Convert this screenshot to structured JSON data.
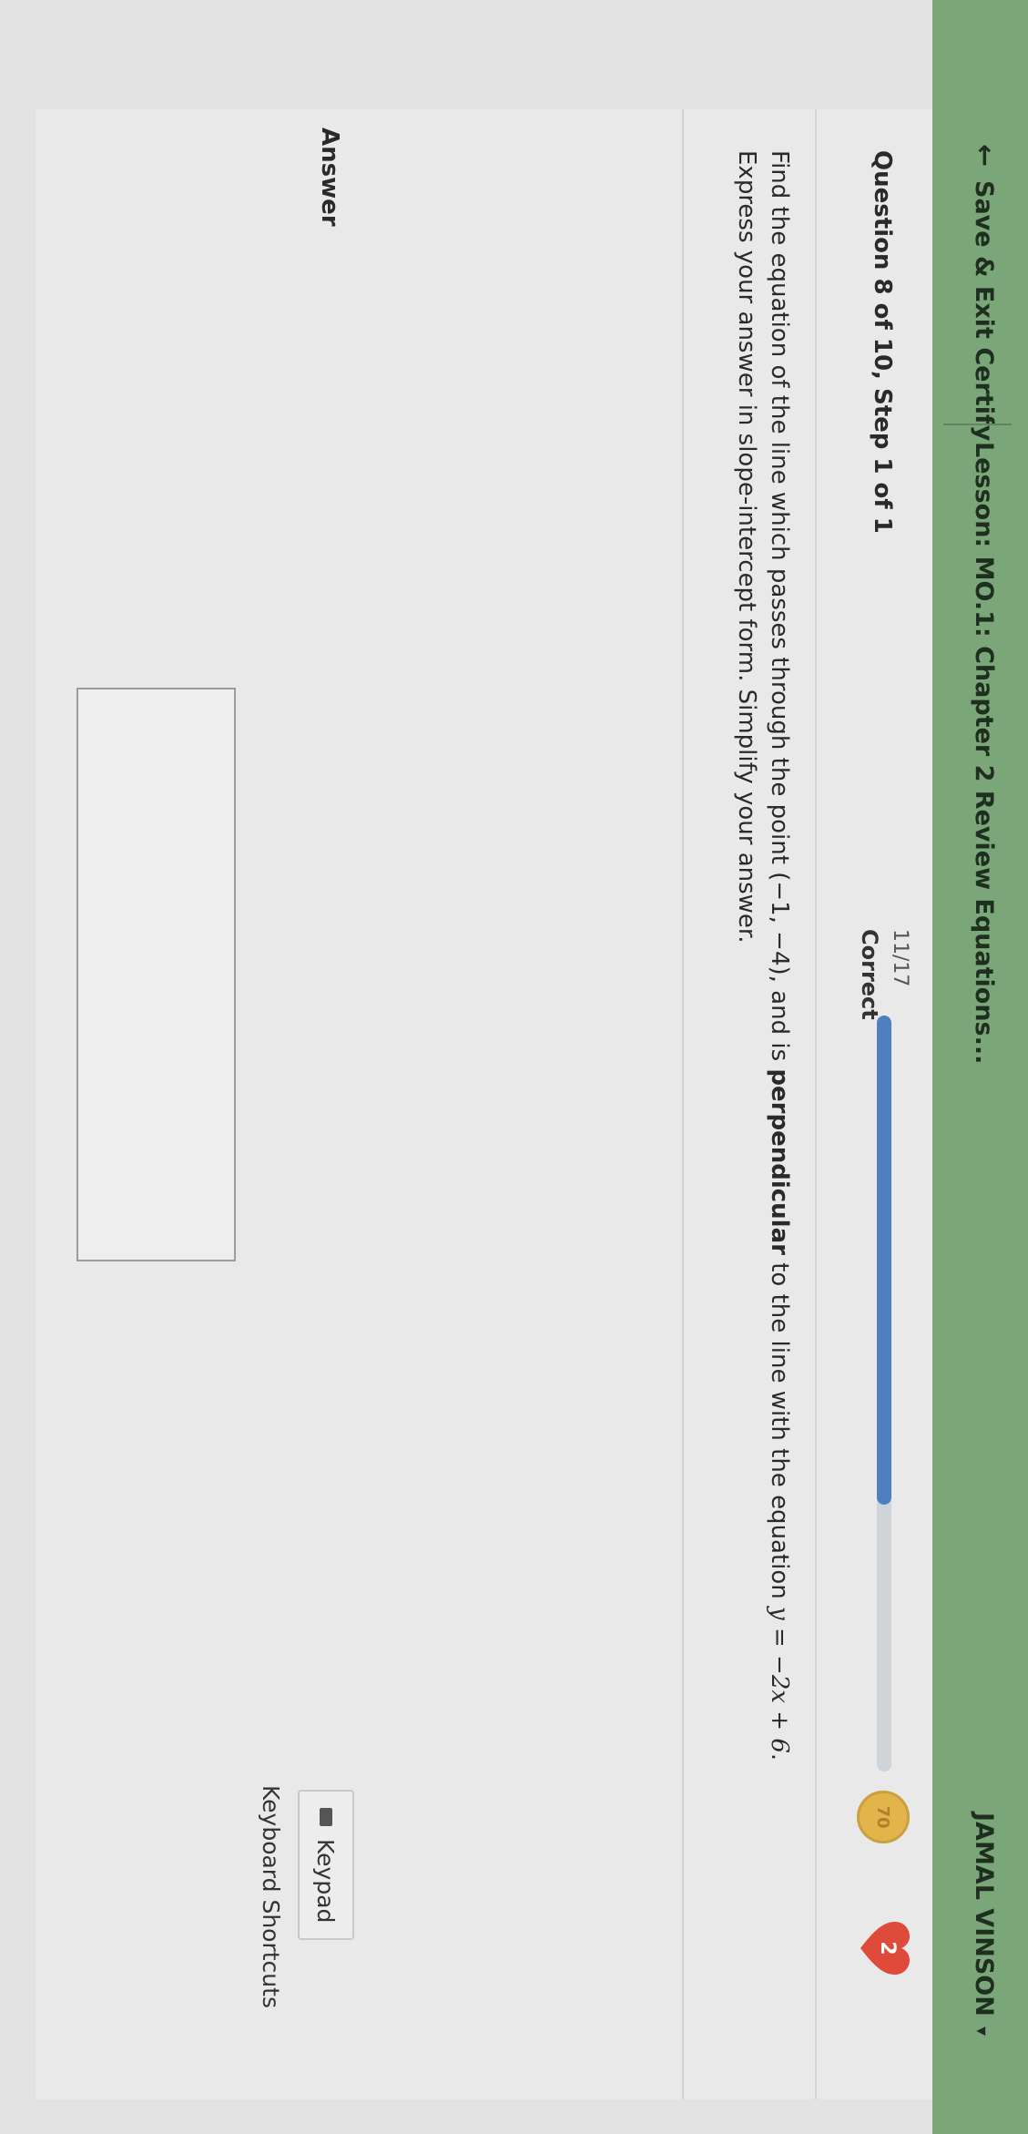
{
  "header": {
    "back_glyph": "←",
    "save_exit": "Save & Exit Certify",
    "lesson": "Lesson: MO.1: Chapter 2 Review Equations...",
    "user_name": "JAMAL VINSON",
    "menu_caret": "▾"
  },
  "progress": {
    "question_label": "Question 8 of 10, Step 1 of 1",
    "fraction": "11/17",
    "status": "Correct",
    "fraction_value": 0.647,
    "medal_label": "70",
    "hearts": "2"
  },
  "question": {
    "text_1": "Find the equation of the line which passes through the point ",
    "point": "(−1, −4)",
    "text_2": ", and is ",
    "emphasis": "perpendicular",
    "text_3": " to the line with the equation ",
    "equation": "y = −2x + 6",
    "text_4": ".",
    "line_2": "Express your answer in slope-intercept form. Simplify your answer."
  },
  "answer": {
    "label": "Answer",
    "value": ""
  },
  "tools": {
    "keypad_label": "Keypad",
    "shortcuts_label": "Keyboard Shortcuts"
  },
  "colors": {
    "header_bg": "#7aa67a",
    "progress_fill": "#4d7fc1",
    "heart": "#e04a3a",
    "medal": "#e2b54a"
  }
}
